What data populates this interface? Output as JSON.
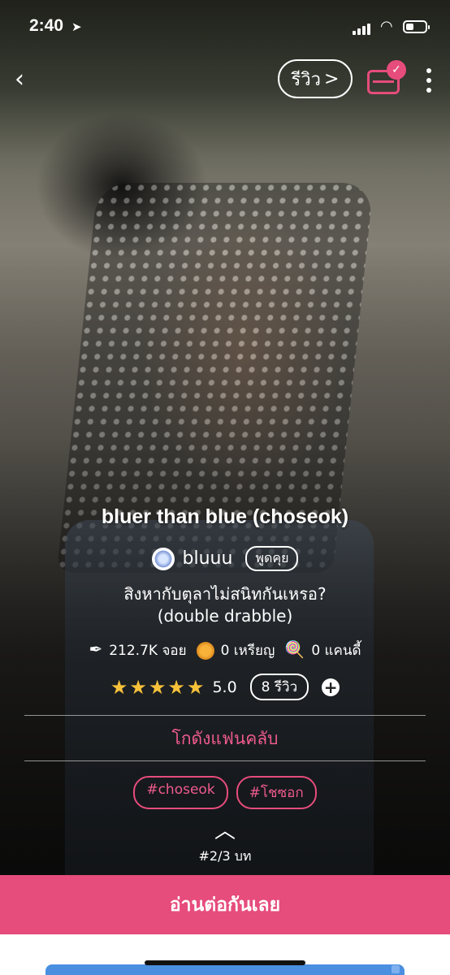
{
  "status_bar": {
    "time": "2:40",
    "location_icon": "location-arrow-icon"
  },
  "top_bar": {
    "back_icon": "chevron-left-icon",
    "review_button_label": "รีวิว",
    "review_button_chevron": ">",
    "inbox_icon": "inbox-check-icon",
    "more_icon": "more-vertical-icon"
  },
  "story": {
    "title": "bluer than blue (choseok)",
    "author": "bluuu",
    "chat_label": "พูดคุย",
    "description_line1": "สิงหากับตุลาไม่สนิทกันเหรอ?",
    "description_line2": "(double drabble)"
  },
  "stats": {
    "views": "212.7K จอย",
    "coins": "0 เหรียญ",
    "candies": "0 แคนดี้"
  },
  "rating": {
    "stars": "★★★★★",
    "score": "5.0",
    "review_count_label": "8 รีวิว",
    "add_label": "+",
    "star_color": "#f6c13a"
  },
  "fanclub_label": "โกดังแฟนคลับ",
  "tags": [
    "#choseok",
    "#โชซอก"
  ],
  "chapter_label": "#2/3 บท",
  "read_button_label": "อ่านต่อกันเลย",
  "colors": {
    "accent": "#e64c7c",
    "accent_text": "#ef5b8d"
  }
}
